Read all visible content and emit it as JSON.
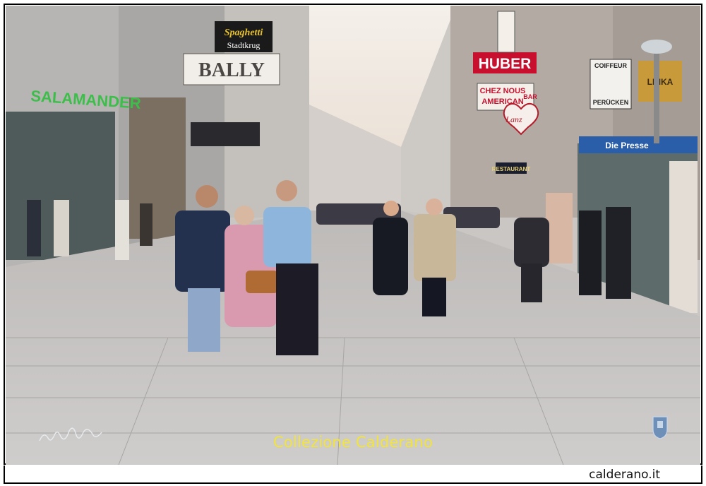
{
  "photo": {
    "signs": {
      "shoe_store": "SALAMANDER",
      "bally": "BALLY",
      "spaghetti": "Spaghetti",
      "spaghetti_sub": "Stadtkrug",
      "huber": "HUBER",
      "chez_nous": "CHEZ NOUS",
      "american": "AMERICAN",
      "american_bar": "BAR",
      "restaurant": "RESTAURANT",
      "lanz": "Lanz",
      "coiffeur": "COIFFEUR",
      "perucken": "PERÜCKEN",
      "kiosk": "Die Presse",
      "linka": "LINKA"
    }
  },
  "caption": "Collezione Calderano",
  "site": "calderano.it",
  "colors": {
    "caption": "#f2e43a",
    "huber_red": "#c8102e",
    "salamander_green": "#3cbf4a"
  }
}
